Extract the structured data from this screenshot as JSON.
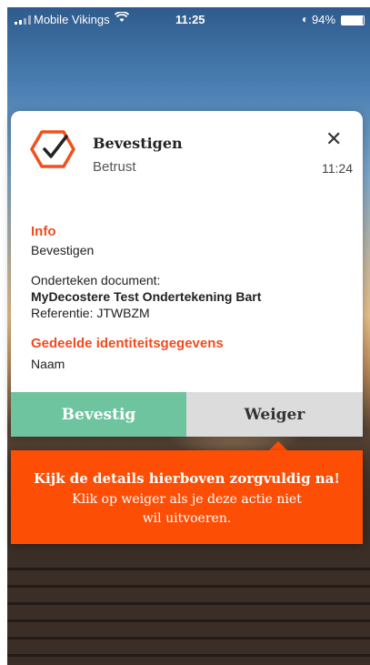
{
  "status_bar": {
    "carrier": "Mobile Vikings",
    "time": "11:25",
    "battery": "94%",
    "battery_level": 0.94,
    "signal_icon": "cellular-signal-icon",
    "wifi_icon": "wifi-icon"
  },
  "notification": {
    "title": "Bevestigen",
    "app_name": "Betrust",
    "time": "11:24",
    "close_icon": "close-icon",
    "logo_color": "#f0501e",
    "info": {
      "label": "Info",
      "value": "Bevestigen"
    },
    "document": {
      "label": "Onderteken document:",
      "name": "MyDecostere Test Ondertekening Bart",
      "reference": "Referentie: JTWBZM"
    },
    "identity": {
      "label": "Gedeelde identiteitsgegevens",
      "value": "Naam"
    },
    "buttons": {
      "confirm": "Bevestig",
      "decline": "Weiger"
    }
  },
  "warning_banner": {
    "title": "Kijk de details hierboven zorgvuldig na!",
    "line1": "Klik op weiger als je deze actie niet",
    "line2": "wil uitvoeren."
  },
  "colors": {
    "accent": "#ee4d20",
    "confirm": "#6ec49f",
    "decline": "#dcdcdc",
    "banner": "#fd4e06"
  }
}
